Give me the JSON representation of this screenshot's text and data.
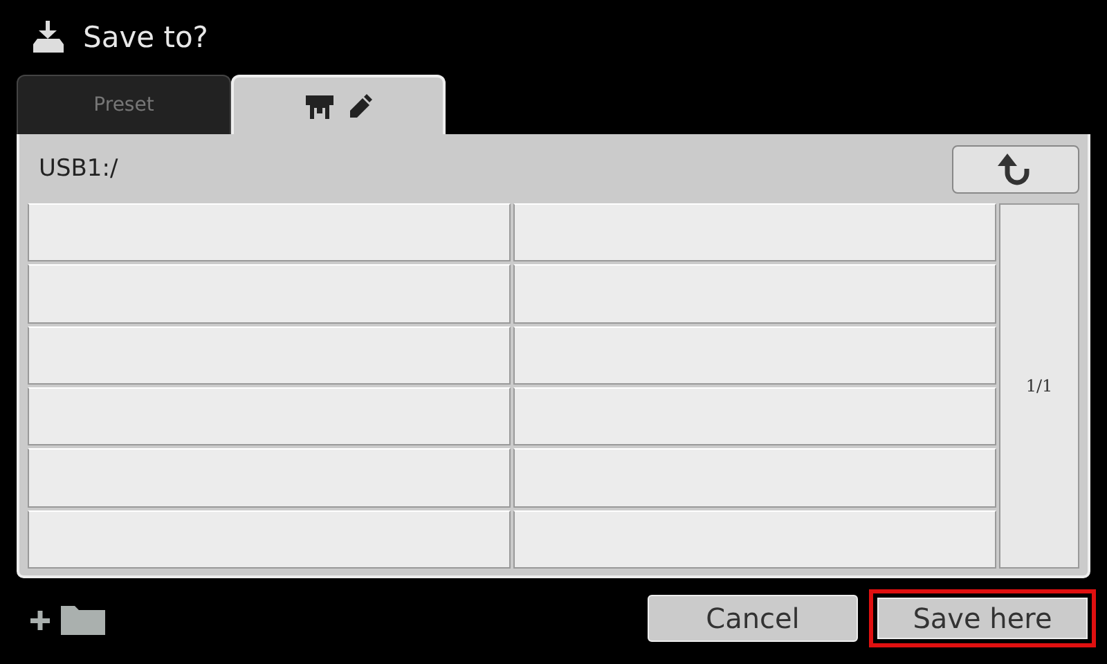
{
  "window": {
    "title": "Save to?"
  },
  "tabs": [
    {
      "kind": "text",
      "label": "Preset",
      "selected": false
    },
    {
      "kind": "icon",
      "selected": true
    }
  ],
  "path": "USB1:/",
  "files": [
    {
      "kind": "empty"
    },
    {
      "kind": "empty"
    },
    {
      "kind": "empty"
    },
    {
      "kind": "empty"
    },
    {
      "kind": "empty"
    },
    {
      "kind": "empty"
    },
    {
      "kind": "empty"
    },
    {
      "kind": "empty"
    },
    {
      "kind": "empty"
    },
    {
      "kind": "empty"
    },
    {
      "kind": "empty"
    },
    {
      "kind": "empty"
    }
  ],
  "page": "1/1",
  "buttons": [
    {
      "label": "Cancel",
      "highlighted": false
    },
    {
      "label": "Save here",
      "highlighted": true
    }
  ]
}
